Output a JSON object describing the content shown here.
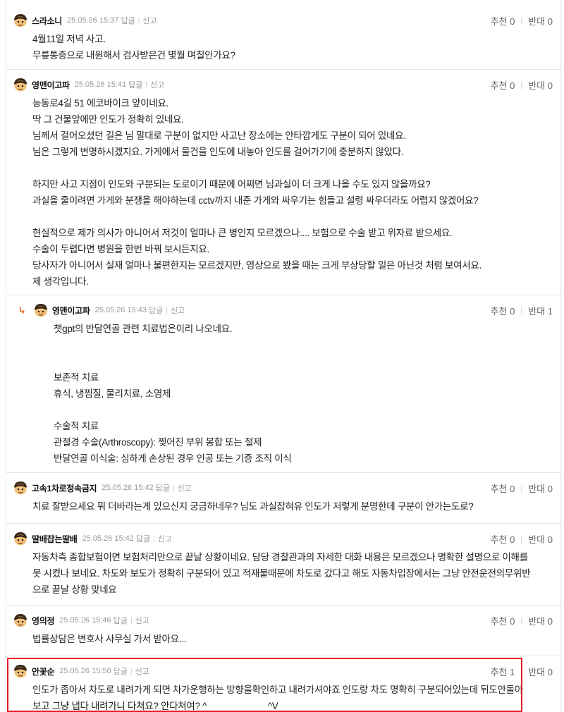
{
  "labels": {
    "reply": "답글",
    "report": "신고",
    "upvote": "추천",
    "downvote": "반대"
  },
  "comments": [
    {
      "nickname": "스라소니",
      "timestamp": "25.05.26 15:37",
      "up": "0",
      "down": "0",
      "lines": [
        "4월11일 저녁 사고.",
        "무릎통증으로 내원해서 검사받은건 몇월 며칠인가요?"
      ]
    },
    {
      "nickname": "영맨이고파",
      "timestamp": "25.05.26 15:41",
      "up": "0",
      "down": "0",
      "lines": [
        "능동로4길 51 에코바이크 앞이네요.",
        "딱 그 건물앞에만 인도가 정확히 있네요.",
        "님께서 걸어오셨던 길은 님 말대로 구분이 없지만 사고난 장소에는 안타깝게도 구분이 되어 있네요.",
        "님은 그렇게 변명하시겠지요. 가게에서 물건을 인도에 내놓아 인도를 걸어가기에 충분하지 않았다.",
        "",
        "하지만 사고 지점이 인도와 구분되는 도로이기 때문에 어쩌면 님과실이 더 크게 나올 수도 있지 않을까요?",
        "과실을 줄이려면 가게와 분쟁을 해야하는데 cctv까지 내준 가게와 싸우기는 힘들고 설령 싸우더라도 어렵지 않겠어요?",
        "",
        "현실적으로 제가 의사가 아니어서 저것이 얼마나 큰 병인지 모르겠으나.... 보험으로 수술 받고 위자료 받으세요.",
        "수술이 두렵다면 병원을 한번 바꿔 보시든지요.",
        "당사자가 아니어서 실재 얼마나 불편한지는 모르겠지만, 영상으로 봤을 때는 크게 부상당할 일은 아닌것 처럼 보여서요.",
        "제 생각입니다."
      ]
    },
    {
      "nickname": "영맨이고파",
      "timestamp": "25.05.26 15:43",
      "up": "0",
      "down": "1",
      "is_reply": true,
      "lines": [
        "챗gpt의 반달연골 관련 치료법은이리 나오네요.",
        "",
        "",
        "보존적 치료",
        "휴식, 냉찜질, 물리치료, 소염제",
        "",
        "수술적 치료",
        "관절경 수술(Arthroscopy): 찢어진 부위 봉합 또는 절제",
        "반달연골 이식술: 심하게 손상된 경우 인공 또는 기증 조직 이식"
      ]
    },
    {
      "nickname": "고속1차로정속금지",
      "timestamp": "25.05.26 15:42",
      "up": "0",
      "down": "0",
      "lines": [
        "치료 잘받으세요 뭐 더바라는게 있으신지 궁금하네우? 님도 과실잡혀유 인도가 저렇게 분명한데 구분이 안가는도로?"
      ]
    },
    {
      "nickname": "딸배잡는딸배",
      "timestamp": "25.05.26 15:42",
      "up": "0",
      "down": "0",
      "lines": [
        "자동차측 종합보험이면 보험처리만으로 끝날 상황이네요. 담당 경찰관과의 자세한 대화 내용은 모르겠으나 명확한 설명으로 이해를",
        "못 시켰나 보네요. 차도와 보도가 정확히 구분되어 있고 적재물때문에 차도로 갔다고 해도 자동차입장에서는 그냥 안전운전의무위반",
        "으로 끝날 상황 맞네요"
      ]
    },
    {
      "nickname": "영의정",
      "timestamp": "25.05.26 15:46",
      "up": "0",
      "down": "0",
      "lines": [
        "법률상담은 변호사 사무실 가서 받아요..."
      ]
    },
    {
      "nickname": "안꽃순",
      "timestamp": "25.05.26 15:50",
      "up": "1",
      "down": "0",
      "lines": [
        "인도가 좁아서 차도로 내려가게 되면 차가운행하는 방향을확인하고 내려가셔야죠 인도랑 차도 명확히 구분되어있는데 뒤도안돌아",
        "보고 그냥 냅다 내려가니 다쳐요? 안다쳐여? ^____________^V"
      ]
    }
  ],
  "colors": {
    "reply_arrow": "#e8601c",
    "highlight_border": "#e21f26"
  }
}
